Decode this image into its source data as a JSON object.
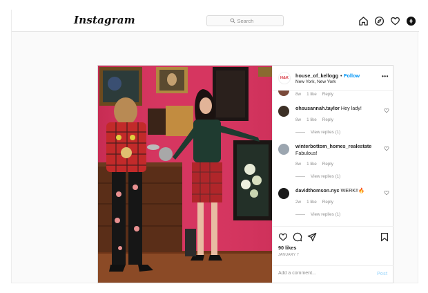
{
  "topbar": {
    "logo": "Instagram",
    "search_placeholder": "Search",
    "icons": [
      "home-icon",
      "explore-compass-icon",
      "activity-heart-icon",
      "profile-avatar"
    ]
  },
  "post": {
    "author": {
      "brand_mark": "H&K",
      "username": "house_of_kellogg",
      "separator": "•",
      "follow_label": "Follow",
      "location": "New York, New York"
    },
    "more_label": "•••",
    "comments": [
      {
        "username": "",
        "text": "",
        "time": "8w",
        "likes": "1 like",
        "reply_label": "Reply",
        "view_replies": ""
      },
      {
        "username": "ohsusannah.taylor",
        "text": "Hey lady!",
        "time": "8w",
        "likes": "1 like",
        "reply_label": "Reply",
        "view_replies": "View replies (1)"
      },
      {
        "username": "winterbottom_homes_realestate",
        "text": "Fabulous!",
        "time": "8w",
        "likes": "1 like",
        "reply_label": "Reply",
        "view_replies": "View replies (1)"
      },
      {
        "username": "davidthomson.nyc",
        "text": "WERK!!🔥",
        "time": "2w",
        "likes": "1 like",
        "reply_label": "Reply",
        "view_replies": "View replies (1)"
      }
    ],
    "likes_count": "90 likes",
    "date": "JANUARY 7",
    "comment_placeholder": "Add a comment...",
    "post_button": "Post"
  },
  "colors": {
    "follow_blue": "#0095f6",
    "post_disabled": "#b2dffc",
    "wall_pink": "#d8345f",
    "muted_text": "#8e8e8e"
  }
}
